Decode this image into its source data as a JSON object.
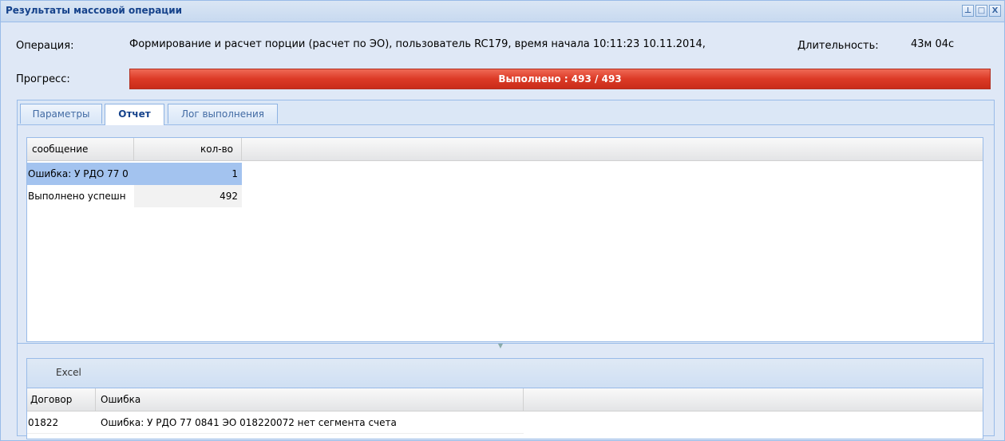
{
  "window": {
    "title": "Результаты массовой операции",
    "tools": [
      "⊥",
      "□",
      "X"
    ]
  },
  "operation": {
    "label": "Операция:",
    "text": "Формирование и расчет порции (расчет по ЭО), пользователь RC179, время начала 10:11:23 10.11.2014,",
    "duration_label": "Длительность:",
    "duration_value": "43м 04с"
  },
  "progress": {
    "label": "Прогресс:",
    "text": "Выполнено : 493 / 493",
    "done": 493,
    "total": 493,
    "fill_color": "#dc3a26"
  },
  "tabs": [
    {
      "label": "Параметры",
      "active": false
    },
    {
      "label": "Отчет",
      "active": true
    },
    {
      "label": "Лог выполнения",
      "active": false
    }
  ],
  "report_grid": {
    "columns": [
      "сообщение",
      "кол-во"
    ],
    "rows": [
      {
        "message": "Ошибка: У РДО 77 0",
        "count": "1",
        "selected": true
      },
      {
        "message": "Выполнено успешн",
        "count": "492",
        "selected": false
      }
    ]
  },
  "error_grid": {
    "toolbar_button": "Excel",
    "columns": [
      "Договор",
      "Ошибка"
    ],
    "rows": [
      {
        "contract": "01822",
        "error": "Ошибка: У РДО 77 0841 ЭО 018220072 нет сегмента счета"
      }
    ]
  }
}
